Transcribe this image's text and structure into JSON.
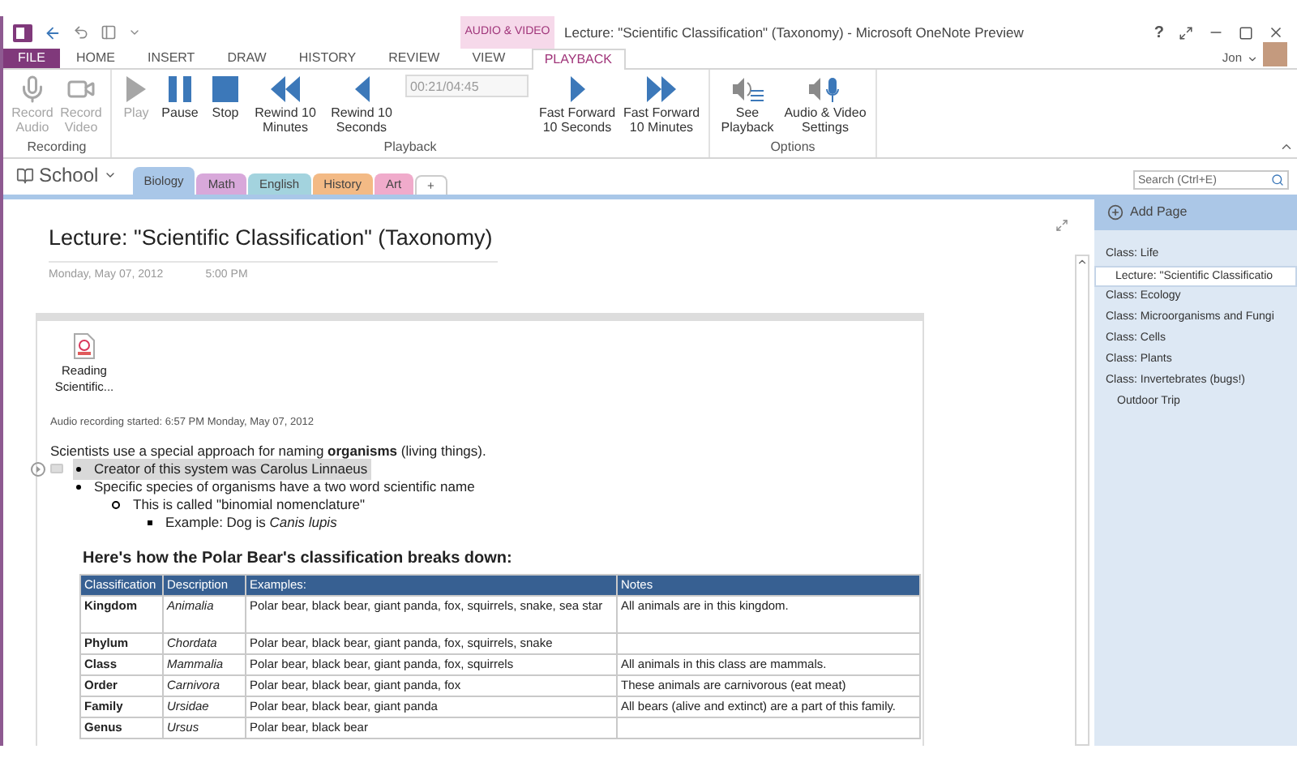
{
  "window": {
    "title": "Lecture: \"Scientific Classification\" (Taxonomy) - Microsoft OneNote Preview",
    "contextual_tab": "AUDIO & VIDEO",
    "help_button": "?",
    "user": "Jon"
  },
  "ribbon_tabs": [
    {
      "label": "FILE",
      "kind": "file",
      "selected": false
    },
    {
      "label": "HOME",
      "kind": "tab",
      "selected": false
    },
    {
      "label": "INSERT",
      "kind": "tab",
      "selected": false
    },
    {
      "label": "DRAW",
      "kind": "tab",
      "selected": false
    },
    {
      "label": "HISTORY",
      "kind": "tab",
      "selected": false
    },
    {
      "label": "REVIEW",
      "kind": "tab",
      "selected": false
    },
    {
      "label": "VIEW",
      "kind": "tab",
      "selected": false
    },
    {
      "label": "PLAYBACK",
      "kind": "tab",
      "selected": true
    }
  ],
  "ribbon_groups": [
    {
      "label": "Recording",
      "items": [
        {
          "kind": "button",
          "label": "Record Audio",
          "disabled": true
        },
        {
          "kind": "button",
          "label": "Record Video",
          "disabled": true
        }
      ]
    },
    {
      "label": "Playback",
      "items": [
        {
          "kind": "button",
          "label": "Play",
          "disabled": true
        },
        {
          "kind": "button",
          "label": "Pause",
          "disabled": false
        },
        {
          "kind": "button",
          "label": "Stop",
          "disabled": false
        },
        {
          "kind": "button",
          "label": "Rewind 10 Minutes",
          "disabled": false
        },
        {
          "kind": "button",
          "label": "Rewind 10 Seconds",
          "disabled": false
        },
        {
          "kind": "field",
          "value": "00:21/04:45"
        },
        {
          "kind": "button",
          "label": "Fast Forward 10 Seconds",
          "disabled": false
        },
        {
          "kind": "button",
          "label": "Fast Forward 10 Minutes",
          "disabled": false
        }
      ]
    },
    {
      "label": "Options",
      "items": [
        {
          "kind": "button",
          "label": "See Playback",
          "disabled": false
        },
        {
          "kind": "button",
          "label": "Audio & Video Settings",
          "disabled": false
        }
      ]
    }
  ],
  "notebook": {
    "name": "School",
    "sections": [
      {
        "label": "Biology",
        "color": "#a9c7e8",
        "selected": true
      },
      {
        "label": "Math",
        "color": "#d8a8da",
        "selected": false
      },
      {
        "label": "English",
        "color": "#a3d3de",
        "selected": false
      },
      {
        "label": "History",
        "color": "#f3ba85",
        "selected": false
      },
      {
        "label": "Art",
        "color": "#f0abcb",
        "selected": false
      }
    ],
    "add_section": "+"
  },
  "search": {
    "placeholder": "Search (Ctrl+E)"
  },
  "page": {
    "title": "Lecture: \"Scientific Classification\" (Taxonomy)",
    "date": "Monday, May 07, 2012",
    "time": "5:00 PM",
    "attachment": "Reading Scientific...",
    "audio_note": "Audio recording started: 6:57 PM Monday, May 07, 2012",
    "intro": "Scientists use a special approach for naming **organisms** (living things).",
    "outline": [
      {
        "text": "Creator of this system was Carolus Linnaeus",
        "selected": true
      },
      {
        "text": "Specific species of organisms have a two word scientific name",
        "selected": false,
        "children": [
          {
            "text": "This is called \"binomial nomenclature\"",
            "selected": false,
            "children": [
              {
                "text": "Example:  Dog is *Canis lupis*",
                "selected": false
              }
            ]
          }
        ]
      }
    ],
    "table_heading": "Here's how the Polar Bear's classification breaks down:",
    "table": {
      "columns": [
        "Classification",
        "Description",
        "Examples:",
        "Notes"
      ],
      "rows": [
        [
          "Kingdom",
          "Animalia",
          "Polar bear, black bear, giant panda, fox, squirrels, snake, sea star",
          "All animals are in this kingdom."
        ],
        [
          "Phylum",
          "Chordata",
          "Polar bear, black bear, giant panda, fox, squirrels, snake",
          ""
        ],
        [
          "Class",
          "Mammalia",
          "Polar bear, black bear, giant panda, fox, squirrels",
          "All animals in this class are mammals."
        ],
        [
          "Order",
          "Carnivora",
          "Polar bear, black bear, giant panda, fox",
          "These animals are carnivorous (eat meat)"
        ],
        [
          "Family",
          "Ursidae",
          "Polar bear, black bear, giant panda",
          "All bears (alive and extinct) are a part of this family."
        ],
        [
          "Genus",
          "Ursus",
          "Polar bear, black bear",
          ""
        ]
      ]
    }
  },
  "pages_panel": {
    "add_page": "Add Page",
    "items": [
      {
        "label": "Class:  Life",
        "selected": false,
        "children": [
          {
            "label": "Lecture: \"Scientific Classificatio",
            "selected": true
          }
        ]
      },
      {
        "label": "Class: Ecology",
        "selected": false
      },
      {
        "label": "Class: Microorganisms and Fungi",
        "selected": false
      },
      {
        "label": "Class: Cells",
        "selected": false
      },
      {
        "label": "Class: Plants",
        "selected": false
      },
      {
        "label": "Class: Invertebrates (bugs!)",
        "selected": false,
        "children": [
          {
            "label": "Outdoor Trip",
            "selected": false
          }
        ]
      }
    ]
  }
}
